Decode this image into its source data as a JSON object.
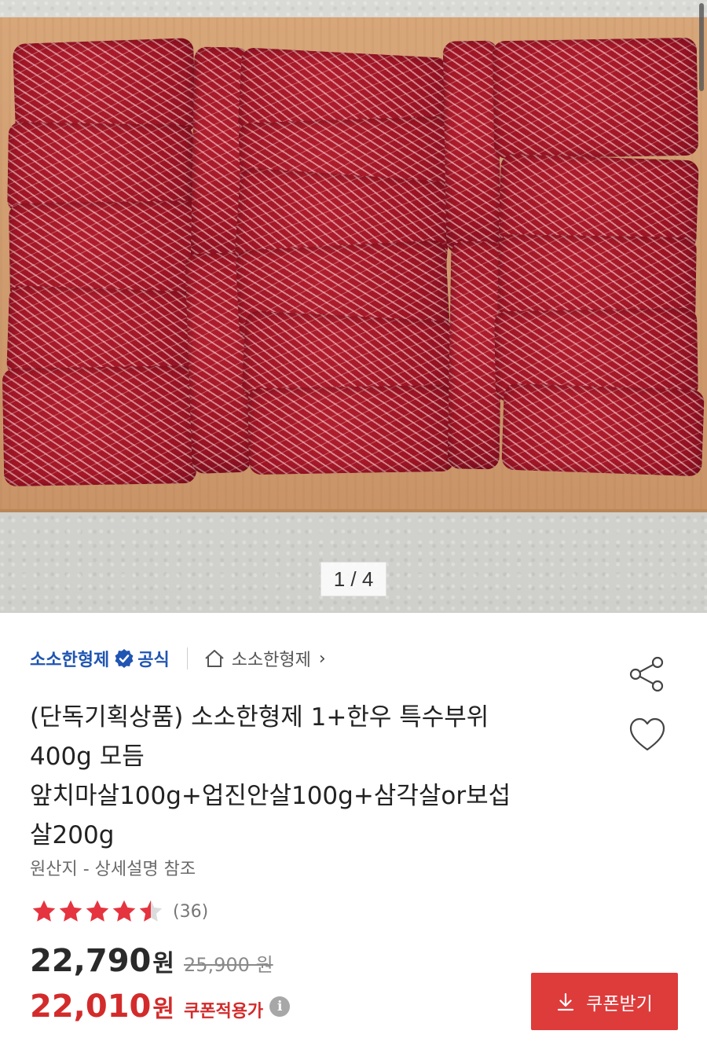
{
  "gallery": {
    "pager_text": "1 / 4"
  },
  "store": {
    "name": "소소한형제",
    "official_label": "공식",
    "home_link_label": "소소한형제",
    "link_color": "#1f55b3"
  },
  "actions": {
    "share_icon": "share-icon",
    "wishlist_icon": "heart-icon"
  },
  "product": {
    "title_lines": [
      "(단독기획상품) 소소한형제 1+한우 특수부위",
      "400g 모듬",
      "앞치마살100g+업진안살100g+삼각살or보섭",
      "살200g"
    ],
    "origin": "원산지 - 상세설명 참조",
    "rating": 4.5,
    "review_count": "(36)",
    "price": "22,790",
    "price_unit": "원",
    "original_price": "25,900 원",
    "coupon_price": "22,010",
    "coupon_unit": "원",
    "coupon_label": "쿠폰적용가",
    "accent_color": "#d32b2b"
  },
  "coupon_button": {
    "label": "쿠폰받기",
    "color": "#de3b3b"
  }
}
